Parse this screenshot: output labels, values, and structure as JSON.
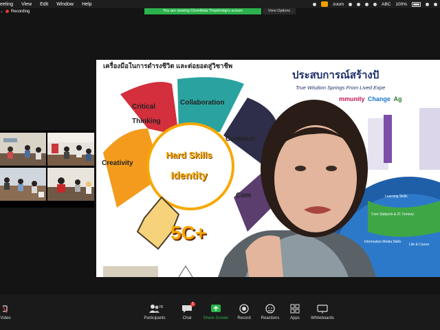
{
  "menubar": {
    "items": [
      "eeting",
      "View",
      "Edit",
      "Window",
      "Help"
    ],
    "zoom_label": "zoom",
    "keyboard": "ABC",
    "battery": "100%"
  },
  "banner": {
    "text": "You are viewing Chonthida Thephinlap's screen",
    "view_options": "View Options"
  },
  "recording": {
    "label": "Recording"
  },
  "slide": {
    "title_left": "เครื่องมือในการดำรงชีวิต และต่อยอดสู่วิชาชีพ",
    "title_right": "ประสบการณ์สร้างปั",
    "subtitle": "True Wisdom Springs From Lived Expe",
    "tags": [
      "mmunity",
      "Change",
      "Ag"
    ],
    "segments": {
      "critical": [
        "Critical",
        "Thinking"
      ],
      "collaboration": "Collaboration",
      "communication": "Commun",
      "creativity": "Creativity",
      "computing": "Com"
    },
    "center_top": "Hard Skills",
    "center_bottom": "Identity",
    "badge": "5C+",
    "globe_labels": [
      "Learning Skills",
      "Core Subjects & 21 Century",
      "Information Media Skills",
      "Life & Career"
    ]
  },
  "toolbar": {
    "participants": {
      "label": "Participants",
      "count": "78"
    },
    "chat": {
      "label": "Chat",
      "badge": "1"
    },
    "share": {
      "label": "Share Screen"
    },
    "record": {
      "label": "Record"
    },
    "reactions": {
      "label": "Reactions"
    },
    "apps": {
      "label": "Apps"
    },
    "whiteboards": {
      "label": "Whiteboards"
    },
    "video": {
      "label": "Video"
    }
  },
  "colors": {
    "share_green": "#2bb24c",
    "record_red": "#e53935",
    "bulb_yellow": "#f6a800",
    "critical_red": "#d32f3c",
    "collab_teal": "#2aa3a0",
    "comm_dark": "#2e2e4a",
    "creativity_orange": "#f49b1e"
  }
}
